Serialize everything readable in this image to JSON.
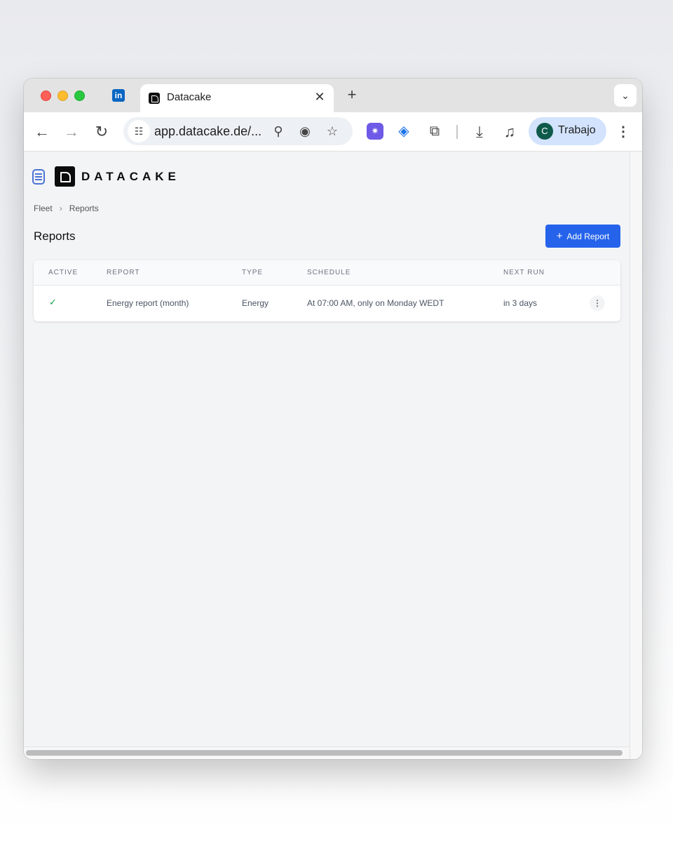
{
  "browser": {
    "pinned_tab_icon": "linkedin-icon",
    "pinned_tab_glyph": "in",
    "tab": {
      "title": "Datacake",
      "close": "✕",
      "favicon": "datacake-icon"
    },
    "new_tab": "+",
    "tab_search": "⌄",
    "nav": {
      "back": "←",
      "forward": "→",
      "reload": "↻"
    },
    "address": {
      "url": "app.datacake.de/...",
      "site_info": "☷",
      "zoom": "⚲",
      "eye": "◉",
      "bookmark": "☆"
    },
    "extensions": [
      "✷",
      "◈",
      "⧉"
    ],
    "download": "⤓",
    "media": "♫",
    "profile": {
      "initial": "C",
      "name": "Trabajo"
    },
    "menu": "⋮"
  },
  "app": {
    "logo_text": "DATACAKE",
    "breadcrumb": [
      "Fleet",
      "Reports"
    ],
    "breadcrumb_separator": "›",
    "page_title": "Reports",
    "add_button_icon": "+",
    "add_button_label": "Add Report",
    "accent_color": "#2563eb",
    "table": {
      "columns": [
        "ACTIVE",
        "REPORT",
        "TYPE",
        "SCHEDULE",
        "NEXT RUN"
      ],
      "rows": [
        {
          "active": "✓",
          "report": "Energy report (month)",
          "type": "Energy",
          "schedule": "At 07:00 AM, only on Monday WEDT",
          "next_run": "in 3 days",
          "menu": "⋮"
        }
      ]
    }
  }
}
